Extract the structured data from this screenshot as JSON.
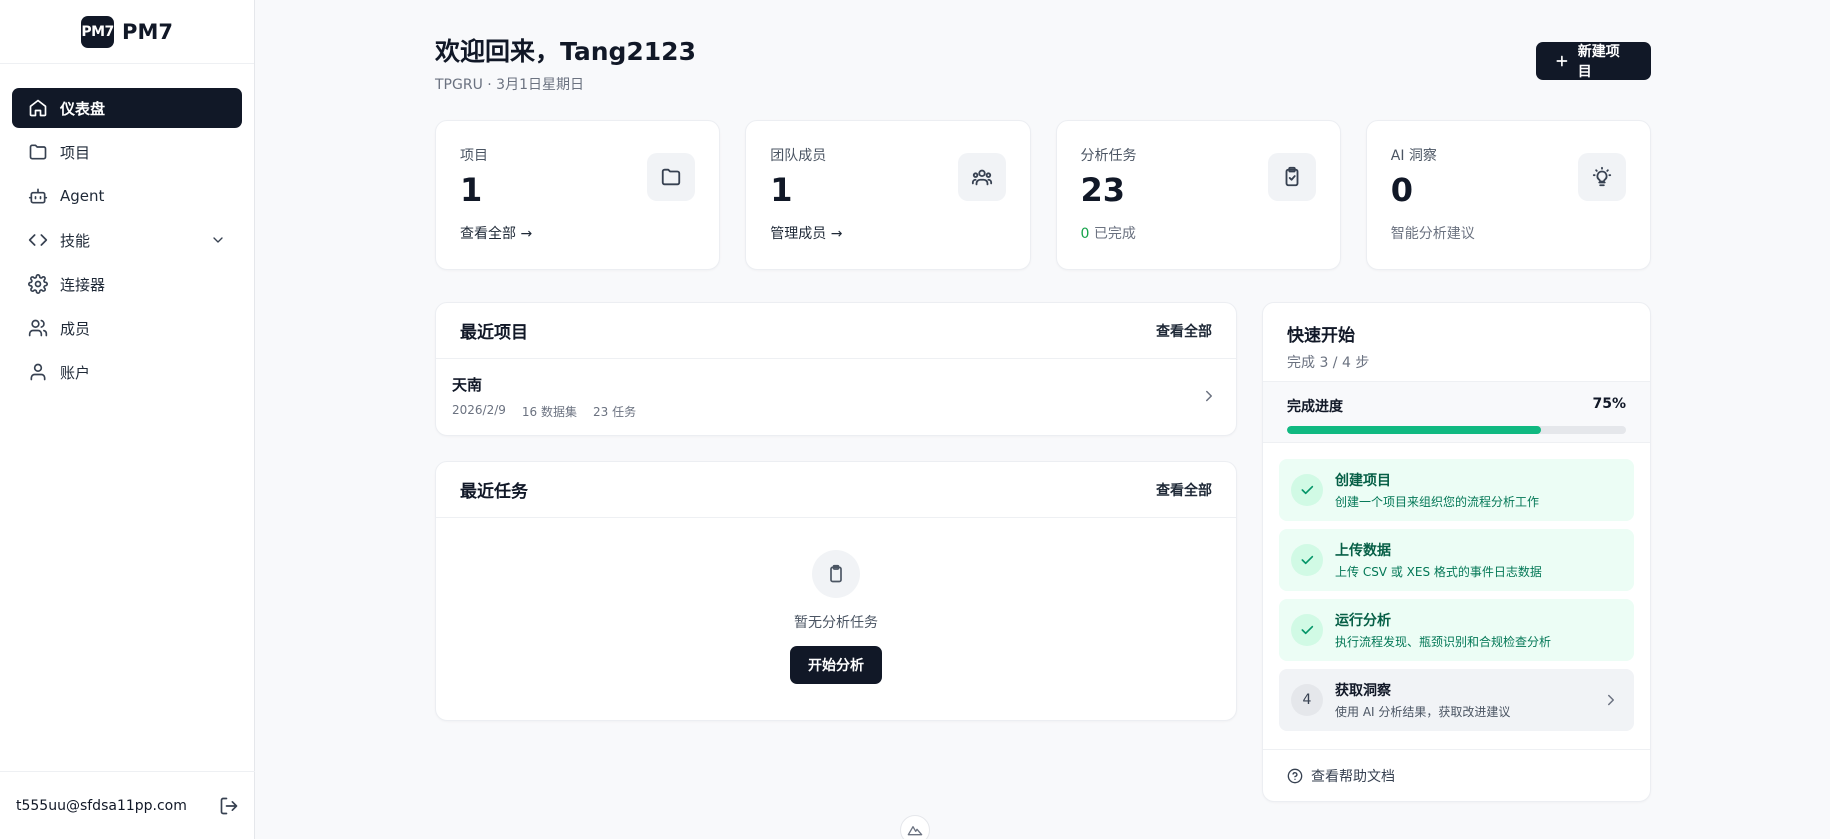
{
  "brand": {
    "logo_text": "PM7",
    "name": "PM7"
  },
  "sidebar": {
    "items": [
      {
        "label": "仪表盘",
        "icon": "home-icon",
        "active": true
      },
      {
        "label": "项目",
        "icon": "folder-icon"
      },
      {
        "label": "Agent",
        "icon": "bot-icon"
      },
      {
        "label": "技能",
        "icon": "code-icon",
        "expandable": true
      },
      {
        "label": "连接器",
        "icon": "gear-icon"
      },
      {
        "label": "成员",
        "icon": "users-icon"
      },
      {
        "label": "账户",
        "icon": "user-icon"
      }
    ],
    "footer": {
      "email": "t555uu@sfdsa11pp.com",
      "logout_icon": "logout-icon"
    }
  },
  "header": {
    "title": "欢迎回来，Tang2123",
    "subtitle": "TPGRU · 3月1日星期日",
    "new_button": "新建项目"
  },
  "stats": [
    {
      "label": "项目",
      "value": "1",
      "link": "查看全部 →",
      "icon": "folder-icon"
    },
    {
      "label": "团队成员",
      "value": "1",
      "link": "管理成员 →",
      "icon": "users-icon"
    },
    {
      "label": "分析任务",
      "value": "23",
      "done_count": "0",
      "done_text": " 已完成",
      "icon": "clipboard-check-icon"
    },
    {
      "label": "AI 洞察",
      "value": "0",
      "link": "智能分析建议",
      "icon": "lightbulb-icon"
    }
  ],
  "recent_projects": {
    "title": "最近项目",
    "action": "查看全部",
    "items": [
      {
        "name": "天南",
        "date": "2026/2/9",
        "datasets": "16 数据集",
        "tasks": "23 任务"
      }
    ]
  },
  "recent_tasks": {
    "title": "最近任务",
    "action": "查看全部",
    "empty_text": "暂无分析任务",
    "start_button": "开始分析"
  },
  "quick_start": {
    "title": "快速开始",
    "subtitle": "完成 3 / 4 步",
    "progress_label": "完成进度",
    "progress_text": "75%",
    "progress_value": 0.75,
    "steps": [
      {
        "title": "创建项目",
        "desc": "创建一个项目来组织您的流程分析工作",
        "done": true
      },
      {
        "title": "上传数据",
        "desc": "上传 CSV 或 XES 格式的事件日志数据",
        "done": true
      },
      {
        "title": "运行分析",
        "desc": "执行流程发现、瓶颈识别和合规检查分析",
        "done": true
      },
      {
        "title": "获取洞察",
        "desc": "使用 AI 分析结果，获取改进建议",
        "done": false,
        "number": "4"
      }
    ],
    "help_text": "查看帮助文档"
  },
  "colors": {
    "primary": "#111827",
    "success": "#10b981",
    "success_bg": "#ecfdf5"
  }
}
